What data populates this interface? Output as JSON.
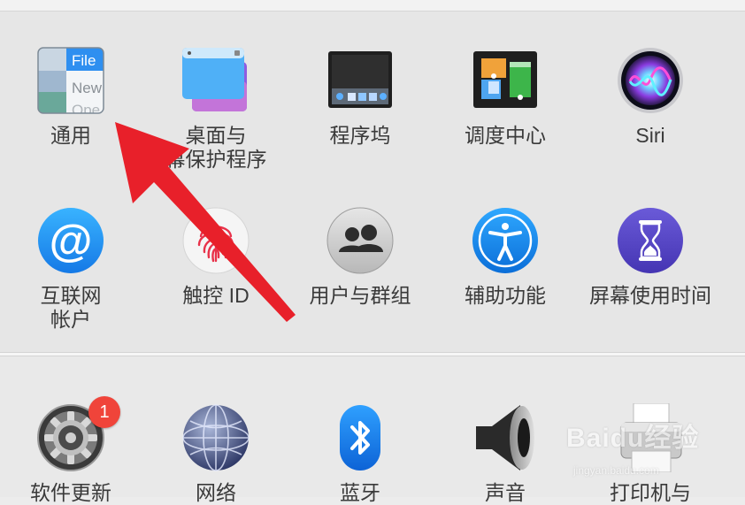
{
  "colors": {
    "accent": "#e8202a",
    "badge": "#f0443a"
  },
  "row1": [
    {
      "id": "general",
      "label": "通用",
      "icon": "general-icon",
      "icon_text": {
        "file": "File",
        "new": "New",
        "open": "Ope"
      }
    },
    {
      "id": "desktop",
      "label": "桌面与\n幕保护程序",
      "icon": "desktop-icon"
    },
    {
      "id": "dock",
      "label": "程序坞",
      "icon": "dock-icon"
    },
    {
      "id": "mission",
      "label": "调度中心",
      "icon": "mission-control-icon"
    },
    {
      "id": "siri",
      "label": "Siri",
      "icon": "siri-icon"
    }
  ],
  "row2": [
    {
      "id": "internet",
      "label": "互联网\n帐户",
      "icon": "at-sign-icon",
      "icon_text": "@"
    },
    {
      "id": "touchid",
      "label": "触控 ID",
      "icon": "fingerprint-icon"
    },
    {
      "id": "users",
      "label": "用户与群组",
      "icon": "users-icon"
    },
    {
      "id": "access",
      "label": "辅助功能",
      "icon": "accessibility-icon"
    },
    {
      "id": "screentime",
      "label": "屏幕使用时间",
      "icon": "hourglass-icon"
    }
  ],
  "row3": [
    {
      "id": "update",
      "label": "软件更新",
      "icon": "gear-icon",
      "badge": "1"
    },
    {
      "id": "network",
      "label": "网络",
      "icon": "globe-icon"
    },
    {
      "id": "bluetooth",
      "label": "蓝牙",
      "icon": "bluetooth-icon"
    },
    {
      "id": "sound",
      "label": "声音",
      "icon": "speaker-icon"
    },
    {
      "id": "printer",
      "label": "打印机与",
      "icon": "printer-icon"
    }
  ],
  "watermark": {
    "text": "Baidu经验",
    "sub": "jingyan.baidu.com"
  }
}
